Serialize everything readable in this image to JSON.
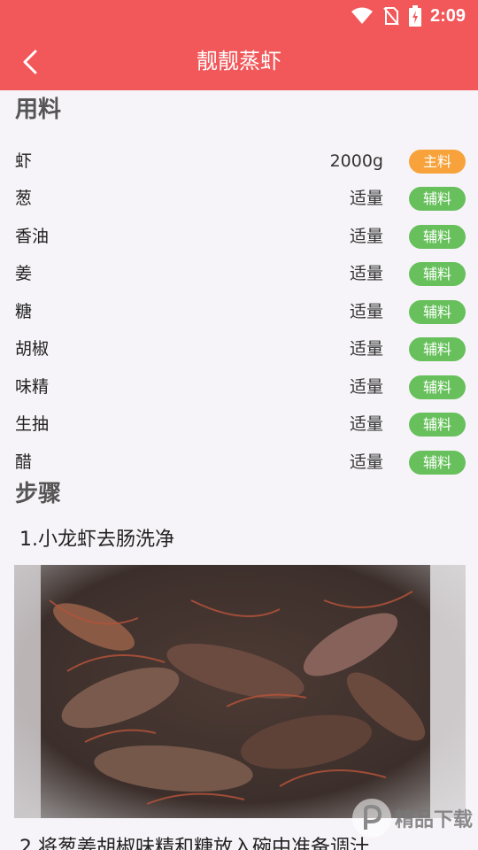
{
  "status_bar": {
    "time": "2:09"
  },
  "header": {
    "title": "靓靓蒸虾"
  },
  "ingredients": {
    "section_title": "用料",
    "items": [
      {
        "name": "虾",
        "amount": "2000g",
        "tag": "主料",
        "tag_type": "main"
      },
      {
        "name": "葱",
        "amount": "适量",
        "tag": "辅料",
        "tag_type": "aux"
      },
      {
        "name": "香油",
        "amount": "适量",
        "tag": "辅料",
        "tag_type": "aux"
      },
      {
        "name": "姜",
        "amount": "适量",
        "tag": "辅料",
        "tag_type": "aux"
      },
      {
        "name": "糖",
        "amount": "适量",
        "tag": "辅料",
        "tag_type": "aux"
      },
      {
        "name": "胡椒",
        "amount": "适量",
        "tag": "辅料",
        "tag_type": "aux"
      },
      {
        "name": "味精",
        "amount": "适量",
        "tag": "辅料",
        "tag_type": "aux"
      },
      {
        "name": "生抽",
        "amount": "适量",
        "tag": "辅料",
        "tag_type": "aux"
      },
      {
        "name": "醋",
        "amount": "适量",
        "tag": "辅料",
        "tag_type": "aux"
      }
    ]
  },
  "steps": {
    "section_title": "步骤",
    "items": [
      {
        "text": "1.小龙虾去肠洗净"
      },
      {
        "text": "2.将葱姜胡椒味精和糖放入碗中准备调汁"
      }
    ]
  },
  "watermark": {
    "text": "精品下载"
  },
  "colors": {
    "header": "#f2585a",
    "main_tag": "#f7a23a",
    "aux_tag": "#67c05c",
    "background": "#f6f4f8"
  }
}
